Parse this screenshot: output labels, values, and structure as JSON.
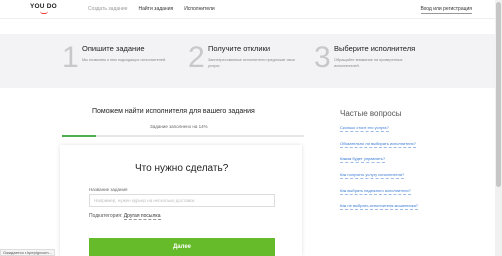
{
  "header": {
    "logo_text": "YOU DO",
    "nav": [
      "Создать задание",
      "Найти задания",
      "Исполнители"
    ],
    "login_label": "Вход или регистрация"
  },
  "steps": [
    {
      "num": "1",
      "title": "Опишите задание",
      "desc": "Мы позвоним о нем подходящих исполнителей."
    },
    {
      "num": "2",
      "title": "Получите отклики",
      "desc": "Заинтересованные исполнители предложат свои услуги."
    },
    {
      "num": "3",
      "title": "Выберите исполнителя",
      "desc": "Обращайте внимание на проверенных исполнителей."
    }
  ],
  "main": {
    "title": "Поможем найти исполнителя для вашего задания",
    "progress_label": "Задание заполнено на 14%",
    "progress_fraction": 0.14
  },
  "form": {
    "heading": "Что нужно сделать?",
    "field_label": "Название задания",
    "field_placeholder": "Например, нужен курьер на несколько доставок",
    "subcategory_label": "Подкатегория:",
    "subcategory_value": "Другая посылка",
    "next_label": "Далее"
  },
  "faq": {
    "title": "Частые вопросы",
    "items": [
      "Сколько стоит это услуга?",
      "Обязательно ли выбирать исполнителя?",
      "Каким будет управлять?",
      "Как получить услугу исполнителя?",
      "Как выбрать надежного исполнителя?",
      "Как не выбрать исполнителя-мошенника?"
    ]
  },
  "status_text": "Ожидается r.hpeplgvcom..."
}
